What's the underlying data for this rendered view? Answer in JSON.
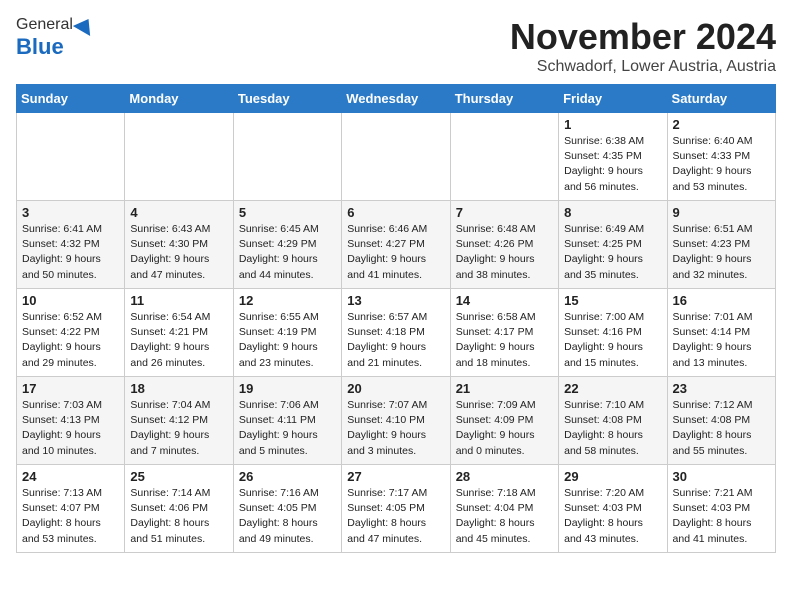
{
  "header": {
    "logo_general": "General",
    "logo_blue": "Blue",
    "title": "November 2024",
    "location": "Schwadorf, Lower Austria, Austria"
  },
  "weekdays": [
    "Sunday",
    "Monday",
    "Tuesday",
    "Wednesday",
    "Thursday",
    "Friday",
    "Saturday"
  ],
  "weeks": [
    [
      {
        "day": "",
        "info": ""
      },
      {
        "day": "",
        "info": ""
      },
      {
        "day": "",
        "info": ""
      },
      {
        "day": "",
        "info": ""
      },
      {
        "day": "",
        "info": ""
      },
      {
        "day": "1",
        "info": "Sunrise: 6:38 AM\nSunset: 4:35 PM\nDaylight: 9 hours\nand 56 minutes."
      },
      {
        "day": "2",
        "info": "Sunrise: 6:40 AM\nSunset: 4:33 PM\nDaylight: 9 hours\nand 53 minutes."
      }
    ],
    [
      {
        "day": "3",
        "info": "Sunrise: 6:41 AM\nSunset: 4:32 PM\nDaylight: 9 hours\nand 50 minutes."
      },
      {
        "day": "4",
        "info": "Sunrise: 6:43 AM\nSunset: 4:30 PM\nDaylight: 9 hours\nand 47 minutes."
      },
      {
        "day": "5",
        "info": "Sunrise: 6:45 AM\nSunset: 4:29 PM\nDaylight: 9 hours\nand 44 minutes."
      },
      {
        "day": "6",
        "info": "Sunrise: 6:46 AM\nSunset: 4:27 PM\nDaylight: 9 hours\nand 41 minutes."
      },
      {
        "day": "7",
        "info": "Sunrise: 6:48 AM\nSunset: 4:26 PM\nDaylight: 9 hours\nand 38 minutes."
      },
      {
        "day": "8",
        "info": "Sunrise: 6:49 AM\nSunset: 4:25 PM\nDaylight: 9 hours\nand 35 minutes."
      },
      {
        "day": "9",
        "info": "Sunrise: 6:51 AM\nSunset: 4:23 PM\nDaylight: 9 hours\nand 32 minutes."
      }
    ],
    [
      {
        "day": "10",
        "info": "Sunrise: 6:52 AM\nSunset: 4:22 PM\nDaylight: 9 hours\nand 29 minutes."
      },
      {
        "day": "11",
        "info": "Sunrise: 6:54 AM\nSunset: 4:21 PM\nDaylight: 9 hours\nand 26 minutes."
      },
      {
        "day": "12",
        "info": "Sunrise: 6:55 AM\nSunset: 4:19 PM\nDaylight: 9 hours\nand 23 minutes."
      },
      {
        "day": "13",
        "info": "Sunrise: 6:57 AM\nSunset: 4:18 PM\nDaylight: 9 hours\nand 21 minutes."
      },
      {
        "day": "14",
        "info": "Sunrise: 6:58 AM\nSunset: 4:17 PM\nDaylight: 9 hours\nand 18 minutes."
      },
      {
        "day": "15",
        "info": "Sunrise: 7:00 AM\nSunset: 4:16 PM\nDaylight: 9 hours\nand 15 minutes."
      },
      {
        "day": "16",
        "info": "Sunrise: 7:01 AM\nSunset: 4:14 PM\nDaylight: 9 hours\nand 13 minutes."
      }
    ],
    [
      {
        "day": "17",
        "info": "Sunrise: 7:03 AM\nSunset: 4:13 PM\nDaylight: 9 hours\nand 10 minutes."
      },
      {
        "day": "18",
        "info": "Sunrise: 7:04 AM\nSunset: 4:12 PM\nDaylight: 9 hours\nand 7 minutes."
      },
      {
        "day": "19",
        "info": "Sunrise: 7:06 AM\nSunset: 4:11 PM\nDaylight: 9 hours\nand 5 minutes."
      },
      {
        "day": "20",
        "info": "Sunrise: 7:07 AM\nSunset: 4:10 PM\nDaylight: 9 hours\nand 3 minutes."
      },
      {
        "day": "21",
        "info": "Sunrise: 7:09 AM\nSunset: 4:09 PM\nDaylight: 9 hours\nand 0 minutes."
      },
      {
        "day": "22",
        "info": "Sunrise: 7:10 AM\nSunset: 4:08 PM\nDaylight: 8 hours\nand 58 minutes."
      },
      {
        "day": "23",
        "info": "Sunrise: 7:12 AM\nSunset: 4:08 PM\nDaylight: 8 hours\nand 55 minutes."
      }
    ],
    [
      {
        "day": "24",
        "info": "Sunrise: 7:13 AM\nSunset: 4:07 PM\nDaylight: 8 hours\nand 53 minutes."
      },
      {
        "day": "25",
        "info": "Sunrise: 7:14 AM\nSunset: 4:06 PM\nDaylight: 8 hours\nand 51 minutes."
      },
      {
        "day": "26",
        "info": "Sunrise: 7:16 AM\nSunset: 4:05 PM\nDaylight: 8 hours\nand 49 minutes."
      },
      {
        "day": "27",
        "info": "Sunrise: 7:17 AM\nSunset: 4:05 PM\nDaylight: 8 hours\nand 47 minutes."
      },
      {
        "day": "28",
        "info": "Sunrise: 7:18 AM\nSunset: 4:04 PM\nDaylight: 8 hours\nand 45 minutes."
      },
      {
        "day": "29",
        "info": "Sunrise: 7:20 AM\nSunset: 4:03 PM\nDaylight: 8 hours\nand 43 minutes."
      },
      {
        "day": "30",
        "info": "Sunrise: 7:21 AM\nSunset: 4:03 PM\nDaylight: 8 hours\nand 41 minutes."
      }
    ]
  ]
}
